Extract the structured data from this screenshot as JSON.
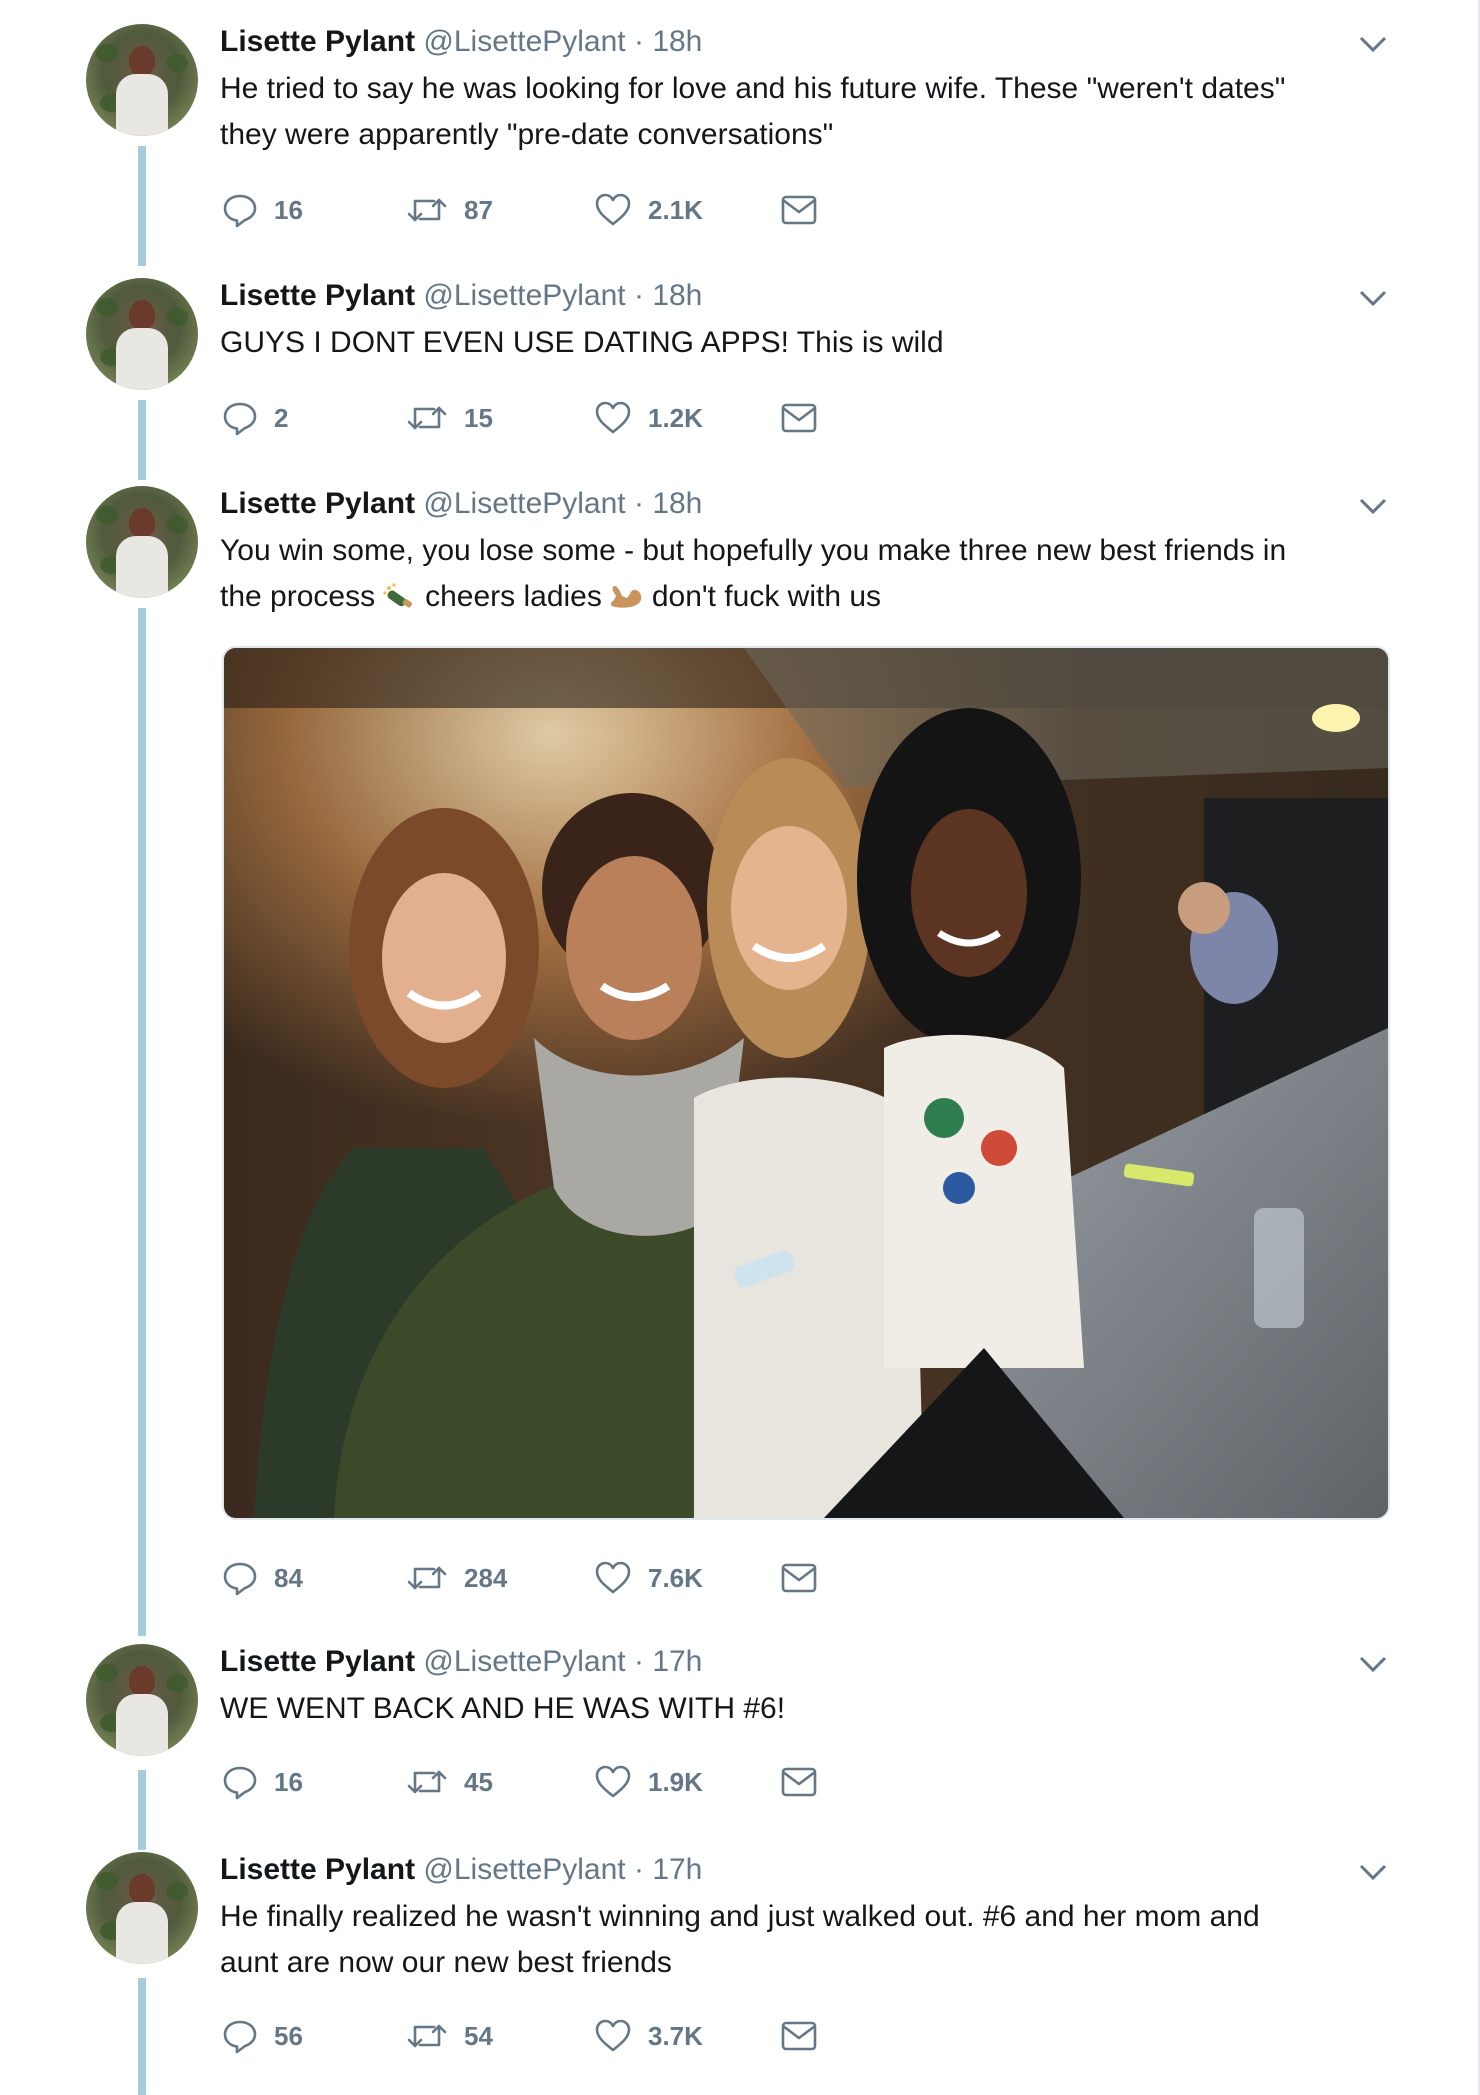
{
  "tweets": [
    {
      "name": "Lisette Pylant",
      "handle": "@LisettePylant",
      "sep": " · ",
      "time": "18h",
      "lines": [
        "He tried to say he was looking for love and his future wife. These \"weren't dates\"",
        "they were apparently \"pre-date conversations\""
      ],
      "replies": "16",
      "retweets": "87",
      "likes": "2.1K"
    },
    {
      "name": "Lisette Pylant",
      "handle": "@LisettePylant",
      "sep": " · ",
      "time": "18h",
      "lines": [
        "GUYS I DONT EVEN USE DATING APPS! This is wild"
      ],
      "replies": "2",
      "retweets": "15",
      "likes": "1.2K"
    },
    {
      "name": "Lisette Pylant",
      "handle": "@LisettePylant",
      "sep": " · ",
      "time": "18h",
      "line1": "You win some, you lose some - but hopefully you make three new best friends in",
      "line2_a": "the process",
      "line2_b": "cheers ladies",
      "line2_c": "don't fuck with us",
      "emoji1": "bottle-with-popping-cork-icon",
      "emoji2": "flexed-biceps-icon",
      "replies": "84",
      "retweets": "284",
      "likes": "7.6K"
    },
    {
      "name": "Lisette Pylant",
      "handle": "@LisettePylant",
      "sep": " · ",
      "time": "17h",
      "lines": [
        "WE WENT BACK AND HE WAS WITH #6!"
      ],
      "replies": "16",
      "retweets": "45",
      "likes": "1.9K"
    },
    {
      "name": "Lisette Pylant",
      "handle": "@LisettePylant",
      "sep": " · ",
      "time": "17h",
      "lines": [
        "He finally realized he wasn't winning and just walked out. #6 and her mom and",
        "aunt are now our new best friends"
      ],
      "replies": "56",
      "retweets": "54",
      "likes": "3.7K"
    }
  ],
  "icons": {
    "reply": "reply-icon",
    "retweet": "retweet-icon",
    "like": "heart-icon",
    "dm": "envelope-icon",
    "more": "chevron-down-icon"
  },
  "colors": {
    "thread_line": "#a7ccd9",
    "action_gray": "#657786",
    "text": "#14171a"
  }
}
